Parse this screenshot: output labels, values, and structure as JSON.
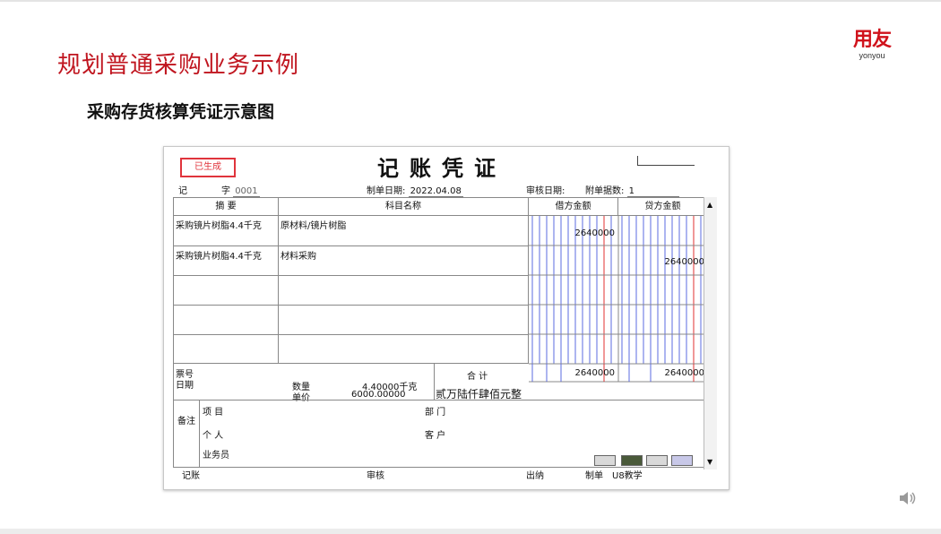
{
  "slide": {
    "title": "规划普通采购业务示例",
    "subtitle": "采购存货核算凭证示意图"
  },
  "logo": {
    "cn": "用友",
    "en": "yonyou"
  },
  "voucher": {
    "stamp": "已生成",
    "title": "记账凭证",
    "word_label": "记",
    "char_label": "字",
    "number": "0001",
    "make_date_label": "制单日期:",
    "make_date": "2022.04.08",
    "audit_date_label": "审核日期:",
    "attach_label": "附单据数:",
    "attach_count": "1",
    "headers": {
      "summary": "摘 要",
      "account": "科目名称",
      "debit": "借方金额",
      "credit": "贷方金额"
    },
    "rows": [
      {
        "summary": "采购镜片树脂4.4千克",
        "account": "原材料/镜片树脂",
        "debit": "2640000",
        "credit": ""
      },
      {
        "summary": "采购镜片树脂4.4千克",
        "account": "材料采购",
        "debit": "",
        "credit": "2640000"
      }
    ],
    "ticket_label": "票号",
    "date_label": "日期",
    "qty_label": "数量",
    "qty_value": "4.40000千克",
    "price_label": "单价",
    "price_value": "6000.00000",
    "total_label": "合 计",
    "total_debit": "2640000",
    "total_credit": "2640000",
    "total_words": "贰万陆仟肆佰元整",
    "remarks_label": "备注",
    "project_label": "项 目",
    "dept_label": "部 门",
    "person_label": "个 人",
    "customer_label": "客 户",
    "salesman_label": "业务员",
    "footer": {
      "bookkeeper": "记账",
      "auditor": "审核",
      "cashier": "出纳",
      "maker_label": "制单",
      "maker": "U8教学"
    }
  },
  "colors": {
    "brand": "#c0151f",
    "stamp": "#e0343c",
    "grid_blue": "#5b6be0",
    "grid_red": "#e03030"
  }
}
